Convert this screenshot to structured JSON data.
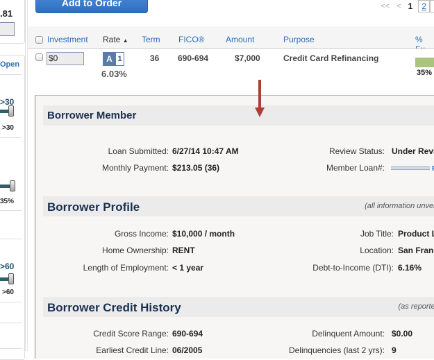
{
  "sidebar": {
    "value_partial": ".81",
    "open_label": "Open",
    "sliders": [
      {
        "top_label": ">30",
        "bottom_label": ">30"
      },
      {
        "top_label": "",
        "bottom_label": "35%"
      },
      {
        "top_label": ">60",
        "bottom_label": ">60"
      }
    ]
  },
  "toolbar": {
    "add_to_order_label": "Add to Order"
  },
  "pager": {
    "first": "<<",
    "prev": "<",
    "current": "1",
    "next_page": "2"
  },
  "table": {
    "headers": {
      "investment": "Investment",
      "rate": "Rate",
      "rate_sort": "▲",
      "term": "Term",
      "fico": "FICO®",
      "amount": "Amount",
      "purpose": "Purpose",
      "funded": "% Fu"
    },
    "rows": [
      {
        "investment": "$0",
        "grade": "A",
        "subgrade": "1",
        "rate": "6.03%",
        "term": "36",
        "fico": "690-694",
        "amount": "$7,000",
        "purpose": "Credit Card Refinancing",
        "funded_pct": 35,
        "funded_label": "35%"
      }
    ]
  },
  "details": {
    "borrower_member": {
      "title": "Borrower Member",
      "left": [
        {
          "label": "Loan Submitted:",
          "value": "6/27/14 10:47 AM"
        },
        {
          "label": "Monthly Payment:",
          "value": "$213.05 (36)"
        }
      ],
      "right": [
        {
          "label": "Review Status:",
          "value": "Under Revi"
        },
        {
          "label": "Member Loan#:",
          "value": "",
          "link_suffix": "F"
        }
      ]
    },
    "borrower_profile": {
      "title": "Borrower Profile",
      "note": "(all information unverified",
      "left": [
        {
          "label": "Gross Income:",
          "value": "$10,000 / month"
        },
        {
          "label": "Home Ownership:",
          "value": "RENT"
        },
        {
          "label": "Length of Employment:",
          "value": "< 1 year"
        }
      ],
      "right": [
        {
          "label": "Job Title:",
          "value": "Product L"
        },
        {
          "label": "Location:",
          "value": "San Franc"
        },
        {
          "label": "Debt-to-Income (DTI):",
          "value": "6.16%"
        }
      ]
    },
    "credit_history": {
      "title": "Borrower Credit History",
      "note": "(as reported b",
      "left": [
        {
          "label": "Credit Score Range:",
          "value": "690-694"
        },
        {
          "label": "Earliest Credit Line:",
          "value": "06/2005"
        }
      ],
      "right": [
        {
          "label": "Delinquent Amount:",
          "value": "$0.00"
        },
        {
          "label": "Delinquencies (last 2 yrs):",
          "value": "9"
        }
      ]
    }
  },
  "colors": {
    "accent_blue": "#2a6ebb",
    "button_blue": "#3a7bcc",
    "funded_bar": "#aac47e",
    "arrow_red": "#a84038",
    "section_title": "#1a2f4f"
  }
}
